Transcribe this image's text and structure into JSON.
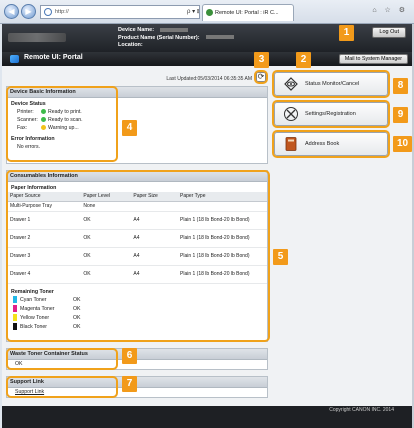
{
  "browser": {
    "nav_back": "◀",
    "nav_forward": "▶",
    "address": "http://",
    "address_tools": "ρ ▾ ⊠ C ✕",
    "tab_title": "Remote UI: Portal : iR C...",
    "window_icons": "⌂ ☆ ⚙"
  },
  "header": {
    "device_name_label": "Device Name:",
    "product_name_label": "Product Name (Serial Number):",
    "location_label": "Location:",
    "logout_label": "Log Out"
  },
  "portal": {
    "title": "Remote UI: Portal",
    "mail_button": "Mail to System Manager",
    "last_updated": "Last Updated:05/03/2014 06:35:35 AM",
    "refresh_icon": "⟳"
  },
  "device_basic": {
    "title": "Device Basic Information",
    "status_heading": "Device Status",
    "statuses": [
      {
        "label": "Printer:",
        "value": "Ready to print.",
        "color": "#3dbb4a"
      },
      {
        "label": "Scanner:",
        "value": "Ready to scan.",
        "color": "#3dbb4a"
      },
      {
        "label": "Fax:",
        "value": "Warning up...",
        "color": "#f2c21a"
      }
    ],
    "error_heading": "Error Information",
    "error_value": "No errors."
  },
  "consumables": {
    "title": "Consumables Information",
    "paper_heading": "Paper Information",
    "columns": [
      "Paper Source",
      "Paper Level",
      "Paper Size",
      "Paper Type"
    ],
    "rows": [
      [
        "Multi-Purpose Tray",
        "None",
        "",
        ""
      ],
      [
        "Drawer 1",
        "OK",
        "A4",
        "Plain 1 (18 lb Bond-20 lb Bond)"
      ],
      [
        "Drawer 2",
        "OK",
        "A4",
        "Plain 1 (18 lb Bond-20 lb Bond)"
      ],
      [
        "Drawer 3",
        "OK",
        "A4",
        "Plain 1 (18 lb Bond-20 lb Bond)"
      ],
      [
        "Drawer 4",
        "OK",
        "A4",
        "Plain 1 (18 lb Bond-20 lb Bond)"
      ]
    ],
    "toner_heading": "Remaining Toner",
    "toners": [
      {
        "name": "Cyan Toner",
        "value": "OK",
        "color": "#22b8e6"
      },
      {
        "name": "Magenta Toner",
        "value": "OK",
        "color": "#e0208a"
      },
      {
        "name": "Yellow Toner",
        "value": "OK",
        "color": "#f4e21a"
      },
      {
        "name": "Black Toner",
        "value": "OK",
        "color": "#111111"
      }
    ]
  },
  "waste": {
    "title": "Waste Toner Container Status",
    "value": "OK"
  },
  "support": {
    "title": "Support Link",
    "link": "Support Link"
  },
  "menu": {
    "status_monitor": "Status Monitor/Cancel",
    "settings": "Settings/Registration",
    "address_book": "Address Book"
  },
  "callouts": [
    "1",
    "2",
    "3",
    "4",
    "5",
    "6",
    "7",
    "8",
    "9",
    "10"
  ],
  "footer": {
    "copyright": "Copyright CANON INC. 2014"
  }
}
